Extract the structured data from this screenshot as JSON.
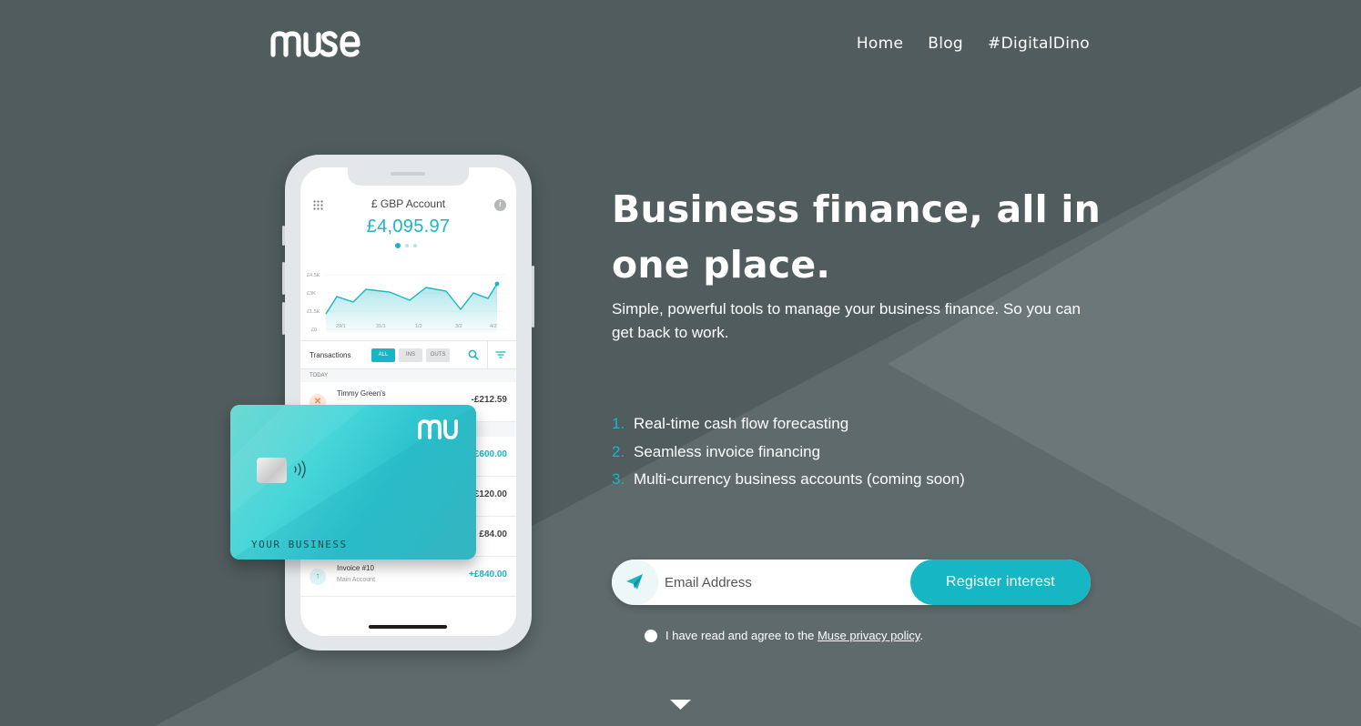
{
  "brand": {
    "logo_text": "muse",
    "accent": "#19b5c3",
    "background": "#505c5d"
  },
  "nav": {
    "items": [
      {
        "label": "Home"
      },
      {
        "label": "Blog"
      },
      {
        "label": "#DigitalDino"
      }
    ]
  },
  "phone": {
    "account_title": "£ GBP Account",
    "balance": "£4,095.97",
    "chart": {
      "y_ticks": [
        "£4.5K",
        "£3K",
        "£1.5K",
        "£0"
      ],
      "x_ticks": [
        "29/1",
        "31/1",
        "1/2",
        "3/2",
        "4/2"
      ]
    },
    "transactions": {
      "label": "Transactions",
      "filters": [
        "ALL",
        "INS",
        "OUTS"
      ],
      "active_filter": "ALL",
      "section": "TODAY",
      "rows": [
        {
          "name": "Timmy Green's",
          "sub": "",
          "amount": "-£212.59"
        },
        {
          "name": "",
          "sub": "",
          "amount": "+£600.00"
        },
        {
          "name": "",
          "sub": "",
          "amount": "£120.00"
        },
        {
          "name": "",
          "sub": "",
          "amount": "£84.00"
        },
        {
          "name": "Invoice #10",
          "sub": "Main Account",
          "amount": "+£840.00"
        }
      ]
    }
  },
  "card": {
    "name": "YOUR BUSINESS",
    "logo_text": "mu"
  },
  "hero": {
    "headline": "Business finance, all in one place.",
    "subline": "Simple, powerful tools to manage your business finance. So you can get back to work.",
    "features": [
      {
        "num": "1.",
        "text": "Real-time cash flow forecasting"
      },
      {
        "num": "2.",
        "text": "Seamless invoice financing"
      },
      {
        "num": "3.",
        "text": "Multi-currency business accounts (coming soon)"
      }
    ]
  },
  "form": {
    "email_placeholder": "Email Address",
    "email_value": "",
    "submit_label": "Register interest",
    "consent_prefix": "I have read and agree to the ",
    "consent_link": "Muse privacy policy",
    "consent_suffix": "."
  },
  "icons": {
    "send": "paper-plane-icon",
    "scroll": "chevron-down-icon",
    "menu": "grid-icon",
    "info": "info-icon"
  }
}
